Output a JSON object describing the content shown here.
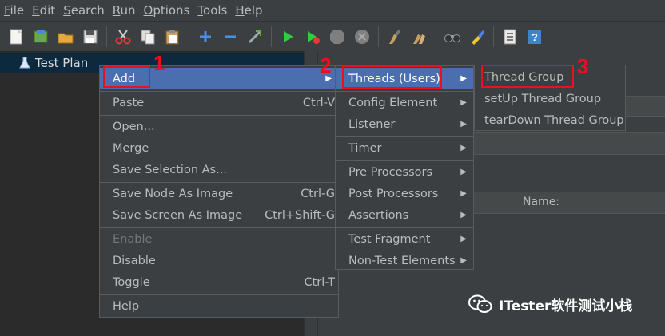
{
  "menubar": {
    "items": [
      {
        "label": "File",
        "key": "F",
        "rest": "ile"
      },
      {
        "label": "Edit",
        "key": "E",
        "rest": "dit"
      },
      {
        "label": "Search",
        "key": "S",
        "rest": "earch"
      },
      {
        "label": "Run",
        "key": "R",
        "rest": "un"
      },
      {
        "label": "Options",
        "key": "O",
        "rest": "ptions"
      },
      {
        "label": "Tools",
        "key": "T",
        "rest": "ools"
      },
      {
        "label": "Help",
        "key": "H",
        "rest": "elp"
      }
    ]
  },
  "toolbar": {
    "icons": [
      "new-icon",
      "templates-icon",
      "open-icon",
      "save-icon",
      "cut-icon",
      "copy-icon",
      "paste-icon",
      "expand-icon",
      "collapse-icon",
      "toggle-icon",
      "start-icon",
      "start-no-pause-icon",
      "stop-icon",
      "shutdown-icon",
      "clear-icon",
      "clear-all-icon",
      "search-icon",
      "reset-search-icon",
      "function-helper-icon",
      "help-icon"
    ]
  },
  "tree": {
    "root_label": "Test Plan"
  },
  "context_menu": {
    "items": [
      {
        "label": "Add",
        "shortcut": "",
        "state": "selected"
      },
      {
        "label": "Paste",
        "shortcut": "Ctrl-V"
      },
      {
        "label": "Open..."
      },
      {
        "label": "Merge"
      },
      {
        "label": "Save Selection As..."
      },
      {
        "label": "Save Node As Image",
        "shortcut": "Ctrl-G"
      },
      {
        "label": "Save Screen As Image",
        "shortcut": "Ctrl+Shift-G"
      },
      {
        "label": "Enable",
        "state": "disabled"
      },
      {
        "label": "Disable"
      },
      {
        "label": "Toggle",
        "shortcut": "Ctrl-T"
      },
      {
        "label": "Help"
      }
    ]
  },
  "add_submenu": {
    "items": [
      {
        "label": "Threads (Users)",
        "state": "selected"
      },
      {
        "label": "Config Element"
      },
      {
        "label": "Listener"
      },
      {
        "label": "Timer"
      },
      {
        "label": "Pre Processors"
      },
      {
        "label": "Post Processors"
      },
      {
        "label": "Assertions"
      },
      {
        "label": "Test Fragment"
      },
      {
        "label": "Non-Test Elements"
      }
    ]
  },
  "threads_submenu": {
    "items": [
      {
        "label": "Thread Group"
      },
      {
        "label": "setUp Thread Group"
      },
      {
        "label": "tearDown Thread Group"
      }
    ]
  },
  "right_panel": {
    "name_label": "Name:"
  },
  "steps": [
    "1",
    "2",
    "3"
  ],
  "watermark": {
    "text": "ITester软件测试小栈"
  },
  "colors": {
    "selection": "#4b6eaf",
    "highlight": "#e8111e",
    "background": "#3c3f41"
  }
}
